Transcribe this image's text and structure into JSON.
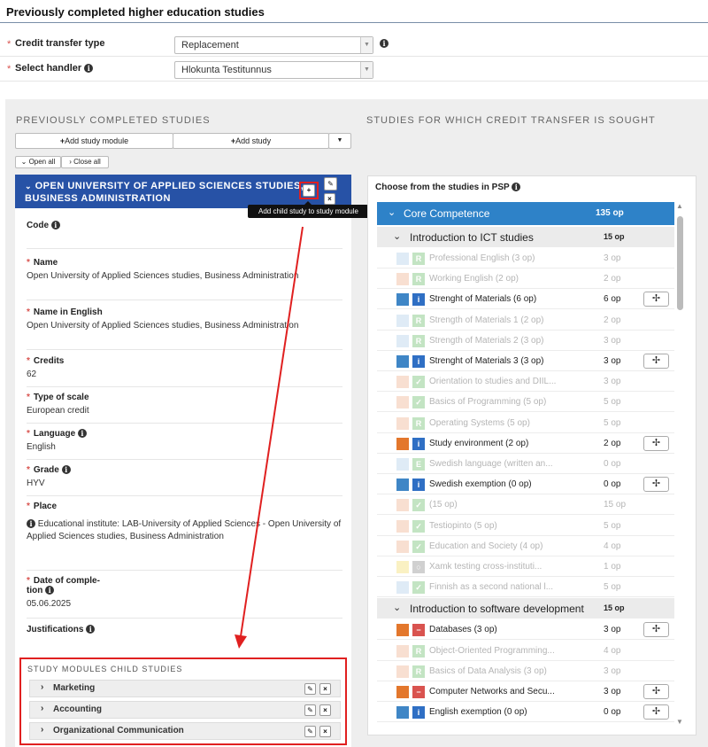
{
  "page": {
    "title": "Previously completed higher education studies"
  },
  "form": {
    "credit_transfer_type": {
      "label": "Credit transfer type",
      "value": "Replacement"
    },
    "select_handler": {
      "label": "Select handler",
      "value": "Hlokunta Testitunnus"
    }
  },
  "left": {
    "section_title": "PREVIOUSLY COMPLETED STUDIES",
    "add_study_module": "Add study module",
    "add_study": "Add study",
    "open_all": "Open all",
    "close_all": "Close all",
    "module_title": "OPEN UNIVERSITY OF APPLIED SCIENCES STUDIES, BUSINESS ADMINISTRATION",
    "tooltip": "Add child study to study module",
    "fields": {
      "code": {
        "label": "Code",
        "value": ""
      },
      "name": {
        "label": "Name",
        "value": "Open University of Applied Sciences studies, Business Administration"
      },
      "name_en": {
        "label": "Name in English",
        "value": "Open University of Applied Sciences studies, Business Administration"
      },
      "credits": {
        "label": "Credits",
        "value": "62"
      },
      "scale": {
        "label": "Type of scale",
        "value": "European credit"
      },
      "language": {
        "label": "Language",
        "value": "English"
      },
      "grade": {
        "label": "Grade",
        "value": "HYV"
      },
      "place": {
        "label": "Place",
        "value": "Educational institute: LAB-University of Applied Sciences - Open University of Applied Sciences studies, Business Administration"
      },
      "date": {
        "label_1": "Date of comple-",
        "label_2": "tion",
        "value": "05.06.2025"
      },
      "justifications": {
        "label": "Justifications"
      }
    },
    "child_title": "STUDY MODULES CHILD STUDIES",
    "children": [
      "Marketing",
      "Accounting",
      "Organizational Communication"
    ]
  },
  "right": {
    "section_title": "STUDIES FOR WHICH CREDIT TRANSFER IS SOUGHT",
    "panel_heading": "Choose from the studies in PSP",
    "root": {
      "label": "Core Competence",
      "credits": "135 op"
    },
    "group1": {
      "label": "Introduction to ICT studies",
      "credits": "15 op"
    },
    "items1": [
      {
        "label": "Professional English (3 op)",
        "credits": "3 op",
        "badge": "R"
      },
      {
        "label": "Working English (2 op)",
        "credits": "2 op",
        "badge": "R"
      },
      {
        "label": "Strenght of Materials (6 op)",
        "credits": "6 op",
        "badge": "i"
      },
      {
        "label": "Strength of Materials 1 (2 op)",
        "credits": "2 op",
        "badge": "R"
      },
      {
        "label": "Strength of Materials 2 (3 op)",
        "credits": "3 op",
        "badge": "R"
      },
      {
        "label": "Strenght of Materials 3 (3 op)",
        "credits": "3 op",
        "badge": "i"
      },
      {
        "label": "Orientation to studies and DIIL...",
        "credits": "3 op",
        "badge": "✓"
      },
      {
        "label": "Basics of Programming (5 op)",
        "credits": "5 op",
        "badge": "✓"
      },
      {
        "label": "Operating Systems (5 op)",
        "credits": "5 op",
        "badge": "R"
      },
      {
        "label": "Study environment (2 op)",
        "credits": "2 op",
        "badge": "i"
      },
      {
        "label": "Swedish language (written an...",
        "credits": "0 op",
        "badge": "E"
      },
      {
        "label": "Swedish exemption (0 op)",
        "credits": "0 op",
        "badge": "i"
      },
      {
        "label": "(15 op)",
        "credits": "15 op",
        "badge": "✓"
      },
      {
        "label": "Testiopinto (5 op)",
        "credits": "5 op",
        "badge": "✓"
      },
      {
        "label": "Education and Society (4 op)",
        "credits": "4 op",
        "badge": "✓"
      },
      {
        "label": "Xamk testing cross-instituti...",
        "credits": "1 op",
        "badge": "○"
      },
      {
        "label": "Finnish as a second national l...",
        "credits": "5 op",
        "badge": "✓"
      }
    ],
    "group2": {
      "label": "Introduction to software development",
      "credits": "15 op"
    },
    "items2": [
      {
        "label": "Databases (3 op)",
        "credits": "3 op",
        "badge": "−"
      },
      {
        "label": "Object-Oriented Programming...",
        "credits": "4 op",
        "badge": "R"
      },
      {
        "label": "Basics of Data Analysis (3 op)",
        "credits": "3 op",
        "badge": "R"
      },
      {
        "label": "Computer Networks and Secu...",
        "credits": "3 op",
        "badge": "−"
      },
      {
        "label": "English exemption (0 op)",
        "credits": "0 op",
        "badge": "i"
      }
    ]
  },
  "colors": {
    "module_header": "#2752a6",
    "tree_root": "#2e82c8",
    "highlight": "#e02020",
    "badge_info": "#2f6fc4",
    "badge_r": "#7cc47c",
    "badge_minus": "#d9534f",
    "sq_blue": "#3f86c6",
    "sq_orange": "#e3772c",
    "sq_yellow": "#f5e07a"
  }
}
